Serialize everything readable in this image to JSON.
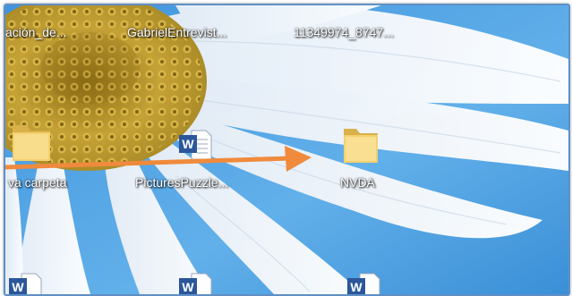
{
  "desktop": {
    "top_row": [
      {
        "label": "ación_de..."
      },
      {
        "label": "GabrielEntrevist..."
      },
      {
        "label": "11349974_8747..."
      }
    ],
    "middle_row": [
      {
        "label": "va carpeta",
        "icon": "folder-icon"
      },
      {
        "label": "PicturesPuzzle...",
        "icon": "word-document-icon"
      },
      {
        "label": "NVDA",
        "icon": "folder-icon"
      }
    ],
    "bottom_row": [
      {
        "icon": "word-document-icon"
      },
      {
        "icon": "word-document-icon"
      },
      {
        "icon": "word-document-icon"
      }
    ]
  },
  "annotation": {
    "type": "arrow",
    "color": "#f08a3c",
    "points_to": "NVDA"
  },
  "colors": {
    "sky": "#5aa9e6",
    "petal": "#f4f7fb",
    "flower_center": "#c9a63b",
    "frame_border": "#5f8fc4"
  }
}
